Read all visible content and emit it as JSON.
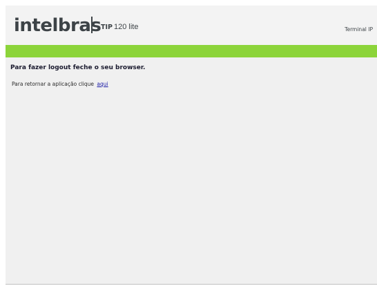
{
  "header": {
    "brand": "intelbras",
    "model_bold": "TIP",
    "model_rest": "120 lite",
    "device_type": "Terminal IP"
  },
  "main": {
    "heading": "Para fazer logout feche o seu browser.",
    "message": "Para retornar a aplicação clique",
    "link_label": "aqui"
  },
  "colors": {
    "accent_green": "#8cd43a",
    "text_dark": "#3d4347",
    "link": "#1a1aa6"
  }
}
